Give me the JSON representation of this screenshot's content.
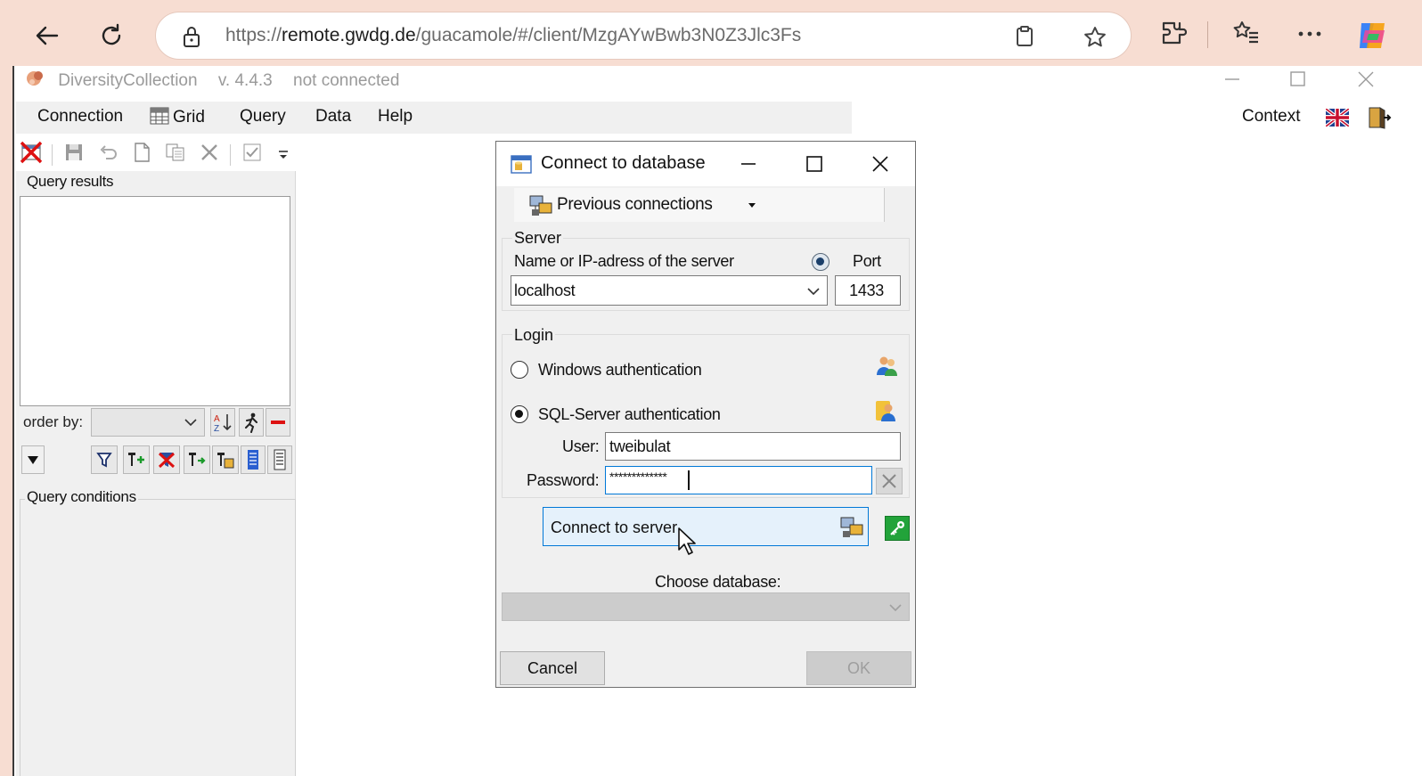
{
  "browser": {
    "url_prefix": "https://",
    "url_host": "remote.gwdg.de",
    "url_path": "/guacamole/#/client/MzgAYwBwb3N0Z3Jlc3Fs"
  },
  "app": {
    "name": "DiversityCollection",
    "version": "v. 4.4.3",
    "status": "not connected",
    "menu": {
      "connection": "Connection",
      "grid": "Grid",
      "query": "Query",
      "data": "Data",
      "help": "Help",
      "context": "Context"
    },
    "left": {
      "query_results": "Query results",
      "order_by": "order by:",
      "query_conditions": "Query conditions"
    }
  },
  "dialog": {
    "title": "Connect to database",
    "previous_connections": "Previous connections",
    "server_group": "Server",
    "server_name_label": "Name or IP-adress of the server",
    "port_label": "Port",
    "server_value": "localhost",
    "port_value": "1433",
    "login_group": "Login",
    "windows_auth": "Windows authentication",
    "sql_auth": "SQL-Server authentication",
    "selected_auth": "sql",
    "user_label": "User:",
    "user_value": "tweibulat",
    "password_label": "Password:",
    "password_mask": "*************",
    "connect_button": "Connect to server",
    "choose_database": "Choose database:",
    "cancel": "Cancel",
    "ok": "OK"
  },
  "colors": {
    "browser_bg": "#f7ddd2",
    "accent": "#0078d7",
    "key_button": "#22a33a"
  }
}
